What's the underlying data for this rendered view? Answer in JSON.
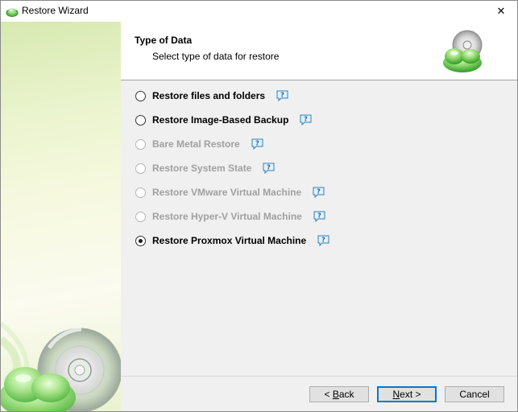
{
  "window": {
    "title": "Restore Wizard",
    "icon": "cloud-disc-icon",
    "close_glyph": "✕"
  },
  "header": {
    "title": "Type of Data",
    "subtitle": "Select type of data for restore"
  },
  "options": [
    {
      "label": "Restore files and folders",
      "checked": false,
      "enabled": true
    },
    {
      "label": "Restore Image-Based Backup",
      "checked": false,
      "enabled": true
    },
    {
      "label": "Bare Metal Restore",
      "checked": false,
      "enabled": false
    },
    {
      "label": "Restore System State",
      "checked": false,
      "enabled": false
    },
    {
      "label": "Restore VMware Virtual Machine",
      "checked": false,
      "enabled": false
    },
    {
      "label": "Restore Hyper-V Virtual Machine",
      "checked": false,
      "enabled": false
    },
    {
      "label": "Restore Proxmox Virtual Machine",
      "checked": true,
      "enabled": true
    }
  ],
  "help_icon": "help-bubble-icon",
  "buttons": {
    "back": {
      "prefix": "< ",
      "accel": "B",
      "rest": "ack"
    },
    "next": {
      "accel": "N",
      "rest": "ext >"
    },
    "cancel": "Cancel"
  },
  "colors": {
    "accent": "#0078d7",
    "disabled_text": "#a0a0a0",
    "brand_green": "#5cc24a"
  }
}
